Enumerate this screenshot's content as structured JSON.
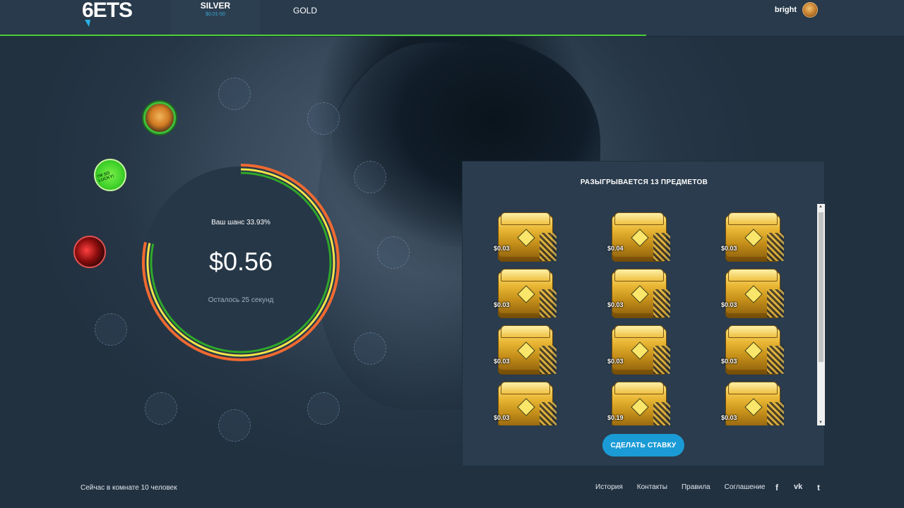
{
  "header": {
    "logo": "6ETS",
    "rooms": [
      {
        "name": "SILVER",
        "range": "$0.01-50",
        "active": true
      },
      {
        "name": "GOLD",
        "range": "",
        "active": false
      }
    ],
    "round_progress_percent": 71.5,
    "user": {
      "name": "bright"
    }
  },
  "pot": {
    "chance_text": "Ваш шанс 33.93%",
    "value": "$0.56",
    "timer_text": "Осталось 25 секунд"
  },
  "players": [
    {
      "avatar": "tiger",
      "color": "#3fbe3a"
    },
    {
      "avatar": "i-m-so-lucky",
      "label": "I'M SO LUCKY!",
      "color": "#3fd12a"
    },
    {
      "avatar": "red-saber",
      "color": "#e05050"
    }
  ],
  "prizes": {
    "title": "РАЗЫГРЫВАЕТСЯ 13 ПРЕДМЕТОВ",
    "items": [
      {
        "price": "$0.03",
        "icon": "gold-case-icon"
      },
      {
        "price": "$0.04",
        "icon": "gold-case-icon"
      },
      {
        "price": "$0.03",
        "icon": "gold-case-icon"
      },
      {
        "price": "$0.03",
        "icon": "gold-case-icon"
      },
      {
        "price": "$0.03",
        "icon": "gold-case-icon"
      },
      {
        "price": "$0.03",
        "icon": "gold-case-icon"
      },
      {
        "price": "$0.03",
        "icon": "gold-case-icon"
      },
      {
        "price": "$0.03",
        "icon": "gold-case-icon"
      },
      {
        "price": "$0.03",
        "icon": "gold-case-icon"
      },
      {
        "price": "$0.03",
        "icon": "gold-case-icon"
      },
      {
        "price": "$0.19",
        "icon": "gold-case-icon"
      },
      {
        "price": "$0.03",
        "icon": "gold-case-icon"
      }
    ],
    "bet_button": "СДЕЛАТЬ СТАВКУ"
  },
  "footer": {
    "online_text": "Сейчас в комнате 10 человек",
    "links": [
      "История",
      "Контакты",
      "Правила",
      "Соглашение"
    ],
    "social": [
      {
        "name": "facebook-icon",
        "glyph": "f"
      },
      {
        "name": "vk-icon",
        "glyph": "vk"
      },
      {
        "name": "twitter-icon",
        "glyph": "t"
      }
    ]
  },
  "colors": {
    "accent": "#1b9bd6",
    "progress": "#4cd13a",
    "ring_orange": "#f06a30",
    "ring_yellow": "#f2e44a",
    "ring_green": "#2fa82a"
  }
}
